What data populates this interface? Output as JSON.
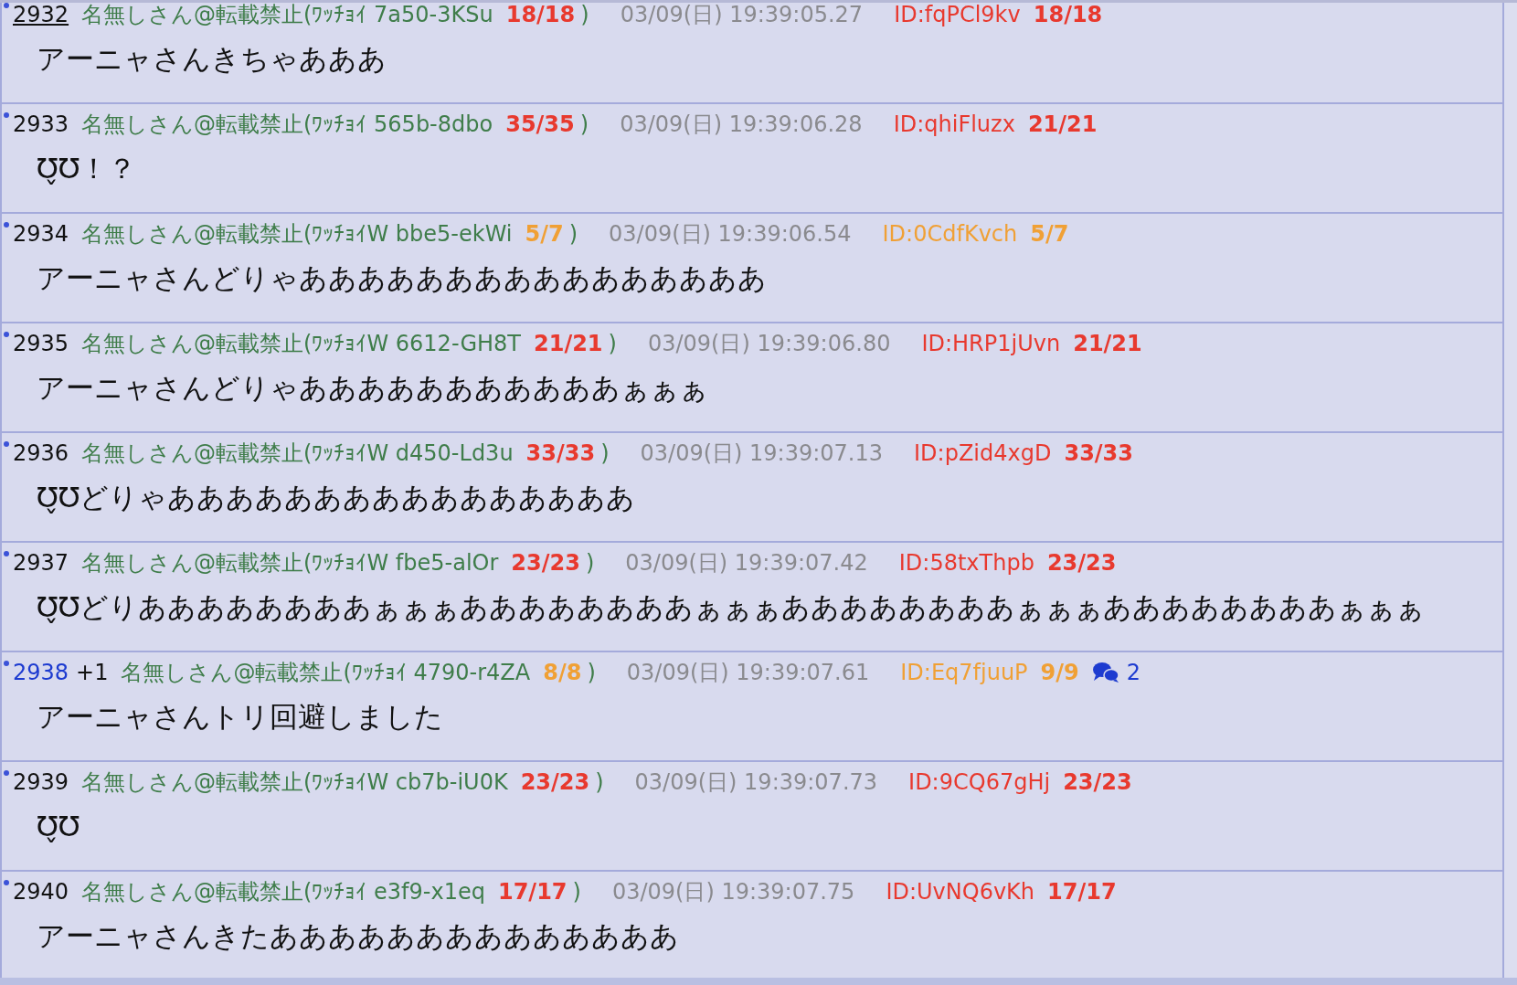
{
  "posts": [
    {
      "number": "2932",
      "selected": true,
      "number_linked": false,
      "name": "名無しさん@転載禁止(ﾜｯﾁｮｲ 7a50-3KSu",
      "name_count": {
        "text": "18/18",
        "color": "#e8392e"
      },
      "close": ")",
      "date": "03/09(日) 19:39:05.27",
      "id": {
        "text": "ID:fqPCl9kv",
        "count": "18/18",
        "color": "#e8392e"
      },
      "body": "アーニャさんきちゃあああ"
    },
    {
      "number": "2933",
      "selected": false,
      "number_linked": false,
      "name": "名無しさん@転載禁止(ﾜｯﾁｮｲ 565b-8dbo",
      "name_count": {
        "text": "35/35",
        "color": "#e8392e"
      },
      "close": ")",
      "date": "03/09(日) 19:39:06.28",
      "id": {
        "text": "ID:qhiFluzx",
        "count": "21/21",
        "color": "#e8392e"
      },
      "body": "Ʊ̬Ʊ！？"
    },
    {
      "number": "2934",
      "selected": false,
      "number_linked": false,
      "name": "名無しさん@転載禁止(ﾜｯﾁｮｲW bbe5-ekWi",
      "name_count": {
        "text": "5/7",
        "color": "#f0a035"
      },
      "close": ")",
      "date": "03/09(日) 19:39:06.54",
      "id": {
        "text": "ID:0CdfKvch",
        "count": "5/7",
        "color": "#f0a035"
      },
      "body": "アーニャさんどりゃああああああああああああああああ"
    },
    {
      "number": "2935",
      "selected": false,
      "number_linked": false,
      "name": "名無しさん@転載禁止(ﾜｯﾁｮｲW 6612-GH8T",
      "name_count": {
        "text": "21/21",
        "color": "#e8392e"
      },
      "close": ")",
      "date": "03/09(日) 19:39:06.80",
      "id": {
        "text": "ID:HRP1jUvn",
        "count": "21/21",
        "color": "#e8392e"
      },
      "body": "アーニャさんどりゃあああああああああああぁぁぁ"
    },
    {
      "number": "2936",
      "selected": false,
      "number_linked": false,
      "name": "名無しさん@転載禁止(ﾜｯﾁｮｲW d450-Ld3u",
      "name_count": {
        "text": "33/33",
        "color": "#e8392e"
      },
      "close": ")",
      "date": "03/09(日) 19:39:07.13",
      "id": {
        "text": "ID:pZid4xgD",
        "count": "33/33",
        "color": "#e8392e"
      },
      "body": "Ʊ̬Ʊどりゃああああああああああああああああ"
    },
    {
      "number": "2937",
      "selected": false,
      "number_linked": false,
      "name": "名無しさん@転載禁止(ﾜｯﾁｮｲW fbe5-alOr",
      "name_count": {
        "text": "23/23",
        "color": "#e8392e"
      },
      "close": ")",
      "date": "03/09(日) 19:39:07.42",
      "id": {
        "text": "ID:58txThpb",
        "count": "23/23",
        "color": "#e8392e"
      },
      "body": "Ʊ̬Ʊどりああああああああぁぁぁああああああああぁぁぁああああああああぁぁぁああああああああぁぁぁ"
    },
    {
      "number": "2938",
      "selected": false,
      "number_linked": true,
      "plus": "+1",
      "name": "名無しさん@転載禁止(ﾜｯﾁｮｲ 4790-r4ZA",
      "name_count": {
        "text": "8/8",
        "color": "#f0a035"
      },
      "close": ")",
      "date": "03/09(日) 19:39:07.61",
      "id": {
        "text": "ID:Eq7fjuuP",
        "count": "9/9",
        "color": "#f0a035"
      },
      "replies": "2",
      "body": "アーニャさんトリ回避しました"
    },
    {
      "number": "2939",
      "selected": false,
      "number_linked": false,
      "name": "名無しさん@転載禁止(ﾜｯﾁｮｲW cb7b-iU0K",
      "name_count": {
        "text": "23/23",
        "color": "#e8392e"
      },
      "close": ")",
      "date": "03/09(日) 19:39:07.73",
      "id": {
        "text": "ID:9CQ67gHj",
        "count": "23/23",
        "color": "#e8392e"
      },
      "body": "Ʊ̬Ʊ"
    },
    {
      "number": "2940",
      "selected": false,
      "number_linked": false,
      "name": "名無しさん@転載禁止(ﾜｯﾁｮｲ e3f9-x1eq",
      "name_count": {
        "text": "17/17",
        "color": "#e8392e"
      },
      "close": ")",
      "date": "03/09(日) 19:39:07.75",
      "id": {
        "text": "ID:UvNQ6vKh",
        "count": "17/17",
        "color": "#e8392e"
      },
      "body": "アーニャさんきたああああああああああああああ"
    }
  ]
}
